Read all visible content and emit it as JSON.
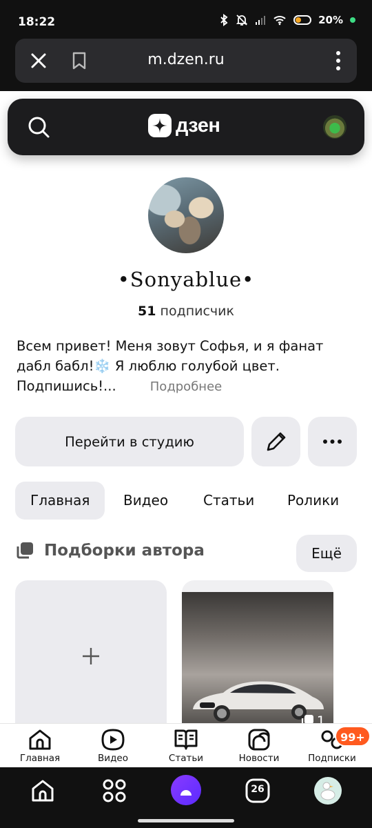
{
  "status_bar": {
    "time": "18:22",
    "battery": "20%",
    "icons": [
      "bluetooth-icon",
      "bell-off-icon",
      "signal-icon",
      "wifi-icon",
      "battery-icon"
    ]
  },
  "browser": {
    "url": "m.dzen.ru",
    "icons": [
      "close-icon",
      "bookmark-icon",
      "more-vertical-icon"
    ]
  },
  "header": {
    "logo_text": "дзен",
    "icons": [
      "search-icon",
      "dzen-logo-icon",
      "user-avatar"
    ]
  },
  "profile": {
    "name": "•Sonyablue•",
    "subscribers_count": "51",
    "subscribers_label": "подписчик",
    "description": "Всем привет! Меня зовут Софья, и я фанат дабл бабл!❄️ Я люблю голубой цвет. Подпишись!...",
    "more_link": "Подробнее"
  },
  "actions": {
    "studio_label": "Перейти в студию",
    "icons": [
      "pencil-icon",
      "more-horizontal-icon"
    ]
  },
  "tabs": [
    {
      "label": "Главная",
      "active": true
    },
    {
      "label": "Видео",
      "active": false
    },
    {
      "label": "Статьи",
      "active": false
    },
    {
      "label": "Ролики",
      "active": false
    }
  ],
  "collections": {
    "title": "Подборки автора",
    "all_label": "Ещё",
    "cards": [
      {
        "type": "new",
        "icon": "plus-icon"
      },
      {
        "type": "collection",
        "count": "1",
        "icon": "collection-icon"
      }
    ]
  },
  "app_nav": {
    "items": [
      {
        "label": "Главная",
        "icon": "home-icon"
      },
      {
        "label": "Видео",
        "icon": "video-icon"
      },
      {
        "label": "Статьи",
        "icon": "articles-icon"
      },
      {
        "label": "Новости",
        "icon": "news-icon"
      },
      {
        "label": "Подписки",
        "icon": "subscriptions-icon"
      }
    ],
    "badge": "99+"
  },
  "system_nav": {
    "calendar_day": "26",
    "icons": [
      "home-icon",
      "apps-grid-icon",
      "alice-icon",
      "calendar-icon",
      "goose-avatar"
    ]
  },
  "colors": {
    "accent_badge": "#ff5a1f",
    "header_bg": "#1c1c1e",
    "button_bg": "#ebebef"
  }
}
